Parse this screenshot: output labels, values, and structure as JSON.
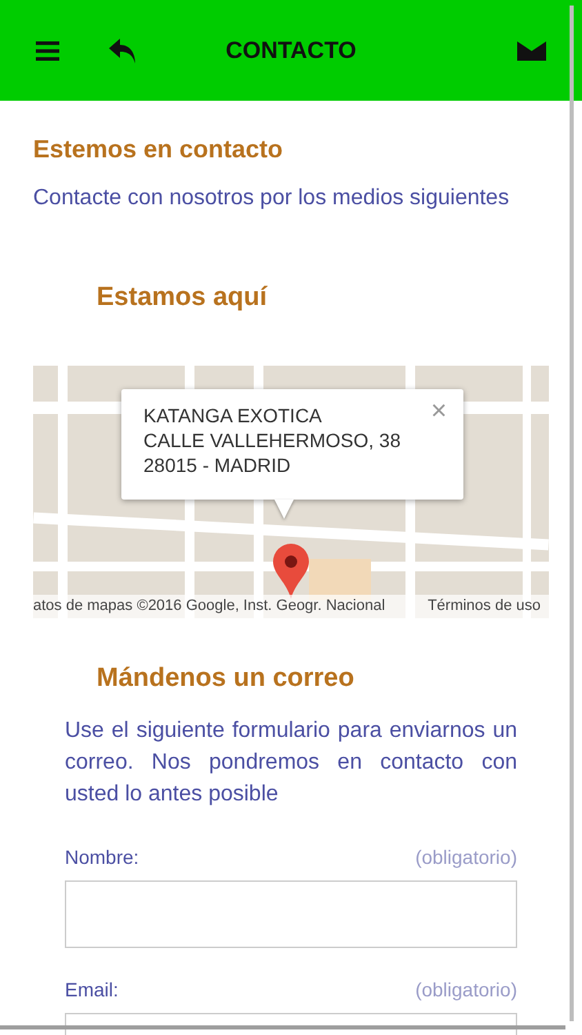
{
  "header": {
    "title": "CONTACTO"
  },
  "intro": {
    "heading": "Estemos en contacto",
    "text": "Contacte con nosotros por los medios siguientes"
  },
  "location": {
    "heading": "Estamos aquí",
    "map": {
      "kind": "picture",
      "info_window": [
        "KATANGA EXOTICA",
        "CALLE VALLEHERMOSO, 38",
        "28015 - MADRID"
      ],
      "close": "×",
      "attribution": "atos de mapas ©2016 Google, Inst. Geogr. Nacional",
      "terms": "Términos de uso"
    }
  },
  "mail": {
    "heading": "Mándenos un correo",
    "text": "Use el siguiente formulario para enviarnos un correo. Nos pondremos en contacto con usted lo antes posible",
    "fields": [
      {
        "label": "Nombre:",
        "hint": "(obligatorio)"
      },
      {
        "label": "Email:",
        "hint": "(obligatorio)"
      }
    ]
  }
}
